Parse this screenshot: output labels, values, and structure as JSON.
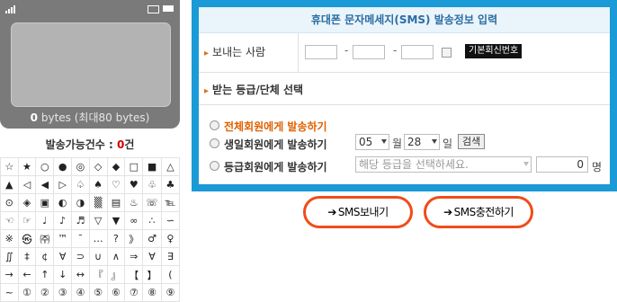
{
  "phone": {
    "bytes_value": "0",
    "bytes_text": "bytes (최대80 bytes)"
  },
  "send_count": {
    "label": "발송가능건수 : ",
    "value": "0",
    "unit": "건"
  },
  "symbols": [
    [
      "☆",
      "★",
      "○",
      "●",
      "◎",
      "◇",
      "◆",
      "□",
      "■",
      "△"
    ],
    [
      "▲",
      "◁",
      "◀",
      "▷",
      "♤",
      "♠",
      "♡",
      "♥",
      "♧",
      "♣"
    ],
    [
      "⊙",
      "◈",
      "▣",
      "◐",
      "◑",
      "▒",
      "▤",
      "♨",
      "☏",
      "℡"
    ],
    [
      "☜",
      "☞",
      "♩",
      "♪",
      "♬",
      "▽",
      "▼",
      "∞",
      "∴",
      "∽"
    ],
    [
      "※",
      "㉿",
      "㈜",
      "™",
      "¯",
      "…",
      "?",
      "》",
      "♂",
      "♀"
    ],
    [
      "∬",
      "‡",
      "¢",
      "∀",
      "⊃",
      "∪",
      "∧",
      "⇒",
      "∀",
      "∃"
    ],
    [
      "→",
      "←",
      "↑",
      "↓",
      "↔",
      "『",
      "』",
      "【",
      "】",
      "("
    ],
    [
      "~",
      "①",
      "②",
      "③",
      "④",
      "⑤",
      "⑥",
      "⑦",
      "⑧",
      "⑨"
    ]
  ],
  "form": {
    "title": "휴대폰 문자메세지(SMS) 발송정보 입력",
    "sender_label": "보내는 사람",
    "dash": "-",
    "default_number_button": "기본회신번호",
    "group_label": "받는 등급/단체 선택",
    "option_all": "전체회원에게 발송하기",
    "option_birthday": "생일회원에게 발송하기",
    "month_value": "05",
    "month_unit": "월",
    "day_value": "28",
    "day_unit": "일",
    "search_button": "검색",
    "option_grade": "등급회원에게 발송하기",
    "grade_placeholder": "해당 등급을 선택하세요.",
    "count_value": "0",
    "count_unit": "명"
  },
  "buttons": {
    "send": "SMS보내기",
    "charge": "SMS충전하기",
    "arrow": "➔"
  },
  "colors": {
    "accent_blue": "#1a9ad6",
    "button_border": "#f04c1a",
    "highlight_orange": "#e06000",
    "count_red": "#d40000"
  }
}
